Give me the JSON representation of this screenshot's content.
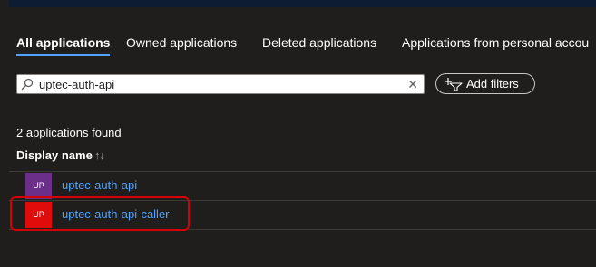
{
  "tabs": [
    {
      "label": "All applications",
      "active": true
    },
    {
      "label": "Owned applications",
      "active": false
    },
    {
      "label": "Deleted applications",
      "active": false
    },
    {
      "label": "Applications from personal accou",
      "active": false
    }
  ],
  "search": {
    "value": "uptec-auth-api",
    "icon": "search-icon",
    "clear_icon": "close-icon",
    "clear_glyph": "✕"
  },
  "filter": {
    "label": "Add filters",
    "icon": "add-filter-icon"
  },
  "results_count": "2 applications found",
  "table": {
    "column_header": "Display name",
    "sort_glyph": "↑↓",
    "rows": [
      {
        "initials": "UP",
        "name": "uptec-auth-api",
        "avatar_color": "#6b2f8a"
      },
      {
        "initials": "UP",
        "name": "uptec-auth-api-caller",
        "avatar_color": "#e00b0b"
      }
    ]
  },
  "colors": {
    "link": "#4fa3ff",
    "highlight": "#d60000",
    "background": "#1f1e1d"
  }
}
